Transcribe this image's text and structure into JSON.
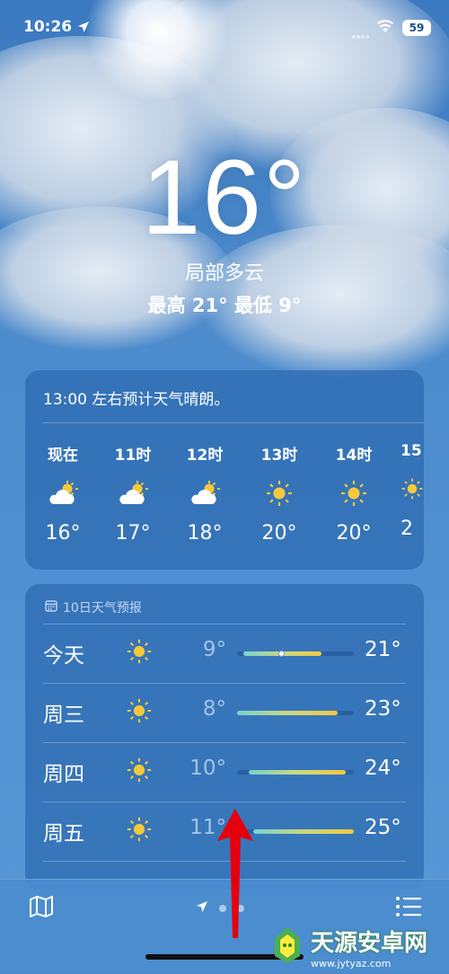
{
  "status": {
    "time": "10:26",
    "battery": "59"
  },
  "current": {
    "temperature": "16°",
    "condition": "局部多云",
    "high_low": "最高 21°  最低 9°"
  },
  "hourly": {
    "summary": "13:00 左右预计天气晴朗。",
    "items": [
      {
        "label": "现在",
        "icon": "partly-cloudy-icon",
        "temp": "16°"
      },
      {
        "label": "11时",
        "icon": "partly-cloudy-icon",
        "temp": "17°"
      },
      {
        "label": "12时",
        "icon": "partly-cloudy-icon",
        "temp": "18°"
      },
      {
        "label": "13时",
        "icon": "sun-icon",
        "temp": "20°"
      },
      {
        "label": "14时",
        "icon": "sun-icon",
        "temp": "20°"
      },
      {
        "label": "15",
        "icon": "sun-icon",
        "temp": "2"
      }
    ]
  },
  "daily": {
    "header": "10日天气预报",
    "days": [
      {
        "name": "今天",
        "icon": "sun-icon",
        "low": "9°",
        "high": "21°",
        "range_start": 0.05,
        "range_end": 0.72,
        "current_marker": 0.38
      },
      {
        "name": "周三",
        "icon": "sun-icon",
        "low": "8°",
        "high": "23°",
        "range_start": 0.0,
        "range_end": 0.86
      },
      {
        "name": "周四",
        "icon": "sun-icon",
        "low": "10°",
        "high": "24°",
        "range_start": 0.1,
        "range_end": 0.93
      },
      {
        "name": "周五",
        "icon": "sun-icon",
        "low": "11°",
        "high": "25°",
        "range_start": 0.14,
        "range_end": 1.0
      }
    ]
  },
  "bottom_bar": {
    "page_count": 3,
    "current_page": 0
  },
  "watermark": {
    "name": "天源安卓网",
    "url": "www.jytyaz.com"
  },
  "colors": {
    "background": "#4f8fd1",
    "card": "#2c69b0",
    "sun": "#f6c93a",
    "arrow": "#e4000f"
  }
}
